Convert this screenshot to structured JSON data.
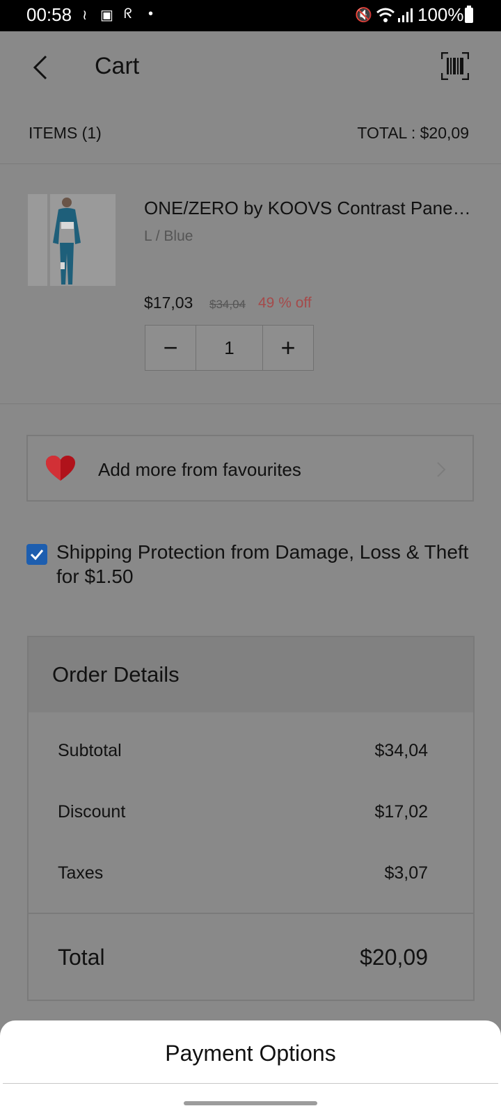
{
  "status_bar": {
    "time": "00:58",
    "battery": "100%",
    "icons": [
      "nfc-icon",
      "voicemail-icon",
      "app-icon",
      "dot-icon",
      "mute-icon",
      "wifi-icon",
      "signal-icon",
      "battery-icon"
    ]
  },
  "header": {
    "title": "Cart",
    "back_icon": "back-arrow-icon",
    "scan_icon": "barcode-icon"
  },
  "summary": {
    "items": "ITEMS (1)",
    "total": "TOTAL : $20,09"
  },
  "product": {
    "title": "ONE/ZERO by KOOVS Contrast Panel Track Jacket",
    "variant": "L / Blue",
    "price": "$17,03",
    "original_price": "$34,04",
    "discount": "49 % off",
    "quantity": "1",
    "minus_label": "−",
    "plus_label": "+"
  },
  "favourites": {
    "label": "Add more from favourites",
    "icon": "heart-icon"
  },
  "shipping": {
    "checked": true,
    "text": "Shipping Protection from Damage, Loss & Theft for $1.50"
  },
  "order_details": {
    "title": "Order Details",
    "rows": [
      {
        "label": "Subtotal",
        "value": "$34,04"
      },
      {
        "label": "Discount",
        "value": "$17,02"
      },
      {
        "label": "Taxes",
        "value": "$3,07"
      }
    ],
    "total_label": "Total",
    "total_value": "$20,09"
  },
  "bottom_sheet": {
    "title": "Payment Options"
  },
  "colors": {
    "overlay": "#898989",
    "checkbox": "#1d5eaf",
    "discount": "#a54a4a",
    "heart": "#b0121b"
  }
}
